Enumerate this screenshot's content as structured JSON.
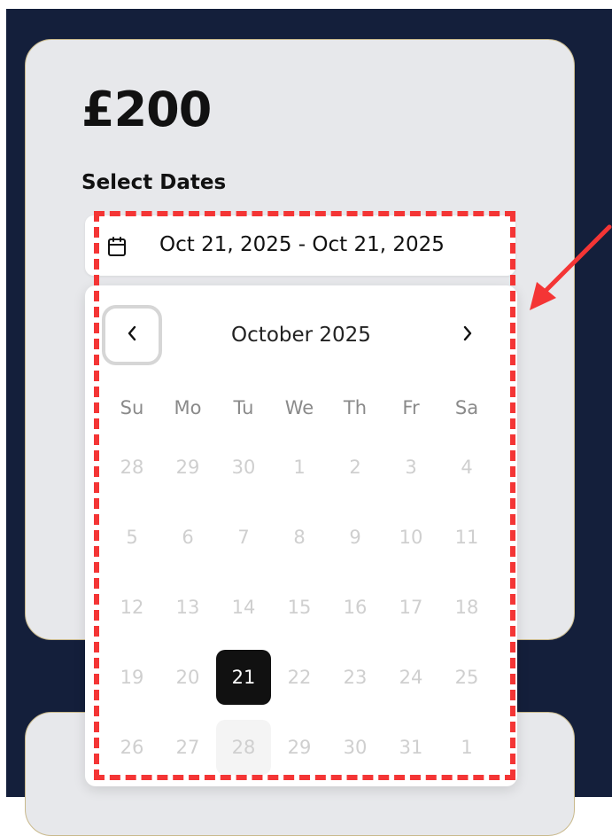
{
  "price": "£200",
  "select_dates_label": "Select Dates",
  "date_range": "Oct 21, 2025 - Oct 21, 2025",
  "calendar": {
    "month_label": "October 2025",
    "weekdays": [
      "Su",
      "Mo",
      "Tu",
      "We",
      "Th",
      "Fr",
      "Sa"
    ],
    "weeks": [
      [
        "28",
        "29",
        "30",
        "1",
        "2",
        "3",
        "4"
      ],
      [
        "5",
        "6",
        "7",
        "8",
        "9",
        "10",
        "11"
      ],
      [
        "12",
        "13",
        "14",
        "15",
        "16",
        "17",
        "18"
      ],
      [
        "19",
        "20",
        "21",
        "22",
        "23",
        "24",
        "25"
      ],
      [
        "26",
        "27",
        "28",
        "29",
        "30",
        "31",
        "1"
      ]
    ],
    "selected_day": "21",
    "highlighted_day": "28"
  },
  "icons": {
    "calendar": "calendar-icon",
    "prev": "chevron-left-icon",
    "next": "chevron-right-icon"
  },
  "colors": {
    "background": "#141f3b",
    "card": "#e7e8eb",
    "selected": "#111111",
    "annotation": "#f43535"
  }
}
